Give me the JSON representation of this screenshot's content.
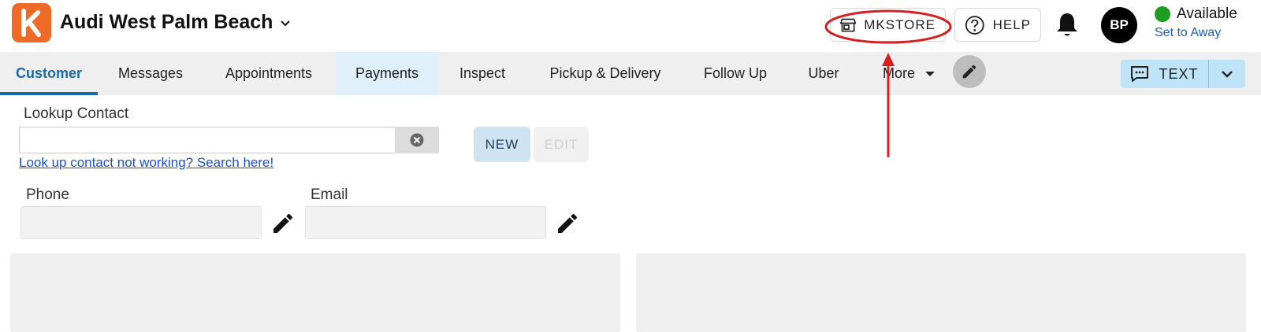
{
  "header": {
    "dealer_name": "Audi West Palm Beach",
    "mkstore_label": "MKSTORE",
    "help_label": "HELP",
    "avatar_initials": "BP",
    "status_text": "Available",
    "set_away_label": "Set to Away",
    "status_color": "#1f9d1f"
  },
  "nav": {
    "tabs": [
      {
        "label": "Customer",
        "active": true
      },
      {
        "label": "Messages"
      },
      {
        "label": "Appointments"
      },
      {
        "label": "Payments",
        "highlighted": true
      },
      {
        "label": "Inspect"
      },
      {
        "label": "Pickup & Delivery"
      },
      {
        "label": "Follow Up"
      },
      {
        "label": "Uber"
      }
    ],
    "more_label": "More",
    "text_button_label": "TEXT"
  },
  "form": {
    "lookup_label": "Lookup Contact",
    "lookup_value": "",
    "lookup_link": "Look up contact not working? Search here!",
    "new_label": "NEW",
    "edit_label": "EDIT",
    "phone_label": "Phone",
    "email_label": "Email",
    "phone_value": "",
    "email_value": ""
  },
  "colors": {
    "brand": "#ef6a26",
    "accent": "#1a6aa8",
    "annotation": "#d42020"
  }
}
